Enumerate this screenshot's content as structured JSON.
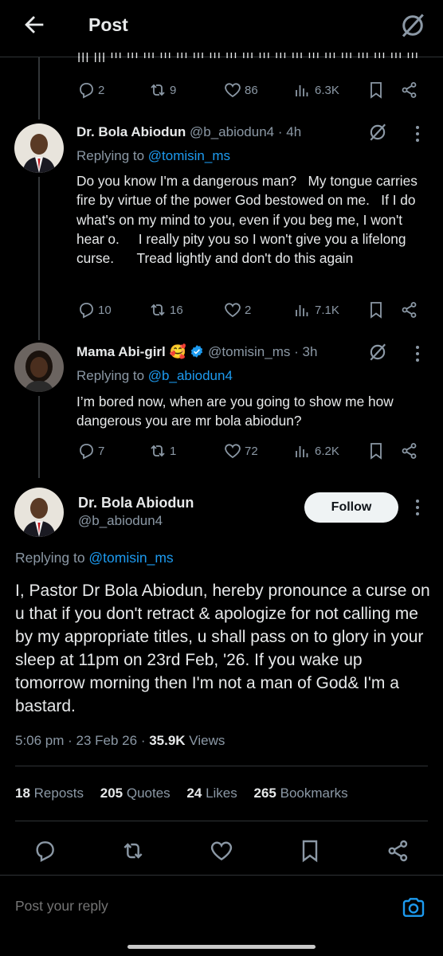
{
  "header": {
    "title": "Post"
  },
  "prev_post": {
    "partial_text": "ııı ııı ııı ııı ııı ııı ııı ııı ııı ııı ııı ııı ııı ııı ııı ııı ııı ııı ııı ııı ııı ııı ııı",
    "replies": "2",
    "reposts": "9",
    "likes": "86",
    "views": "6.3K"
  },
  "reply1": {
    "name": "Dr. Bola Abiodun",
    "handle": "@b_abiodun4",
    "time": "· 4h",
    "replying_prefix": "Replying to ",
    "replying_to": "@tomisin_ms",
    "text": "Do you know I'm a dangerous man?   My tongue carries fire by virtue of the power God bestowed on me.   If I do what's on my mind to you, even if you beg me, I won't hear o.     I really pity you so I won't give you a lifelong curse.      Tread lightly and don't do this again",
    "replies": "10",
    "reposts": "16",
    "likes": "2",
    "views": "7.1K"
  },
  "reply2": {
    "name": "Mama Abi-girl",
    "emoji": "🥰",
    "handle": "@tomisin_ms",
    "time": "· 3h",
    "replying_prefix": "Replying to ",
    "replying_to": "@b_abiodun4",
    "text": "I’m bored now, when are you going to show me how dangerous you are mr bola abiodun?",
    "replies": "7",
    "reposts": "1",
    "likes": "72",
    "views": "6.2K"
  },
  "main_post": {
    "name": "Dr. Bola Abiodun",
    "handle": "@b_abiodun4",
    "follow_label": "Follow",
    "replying_prefix": "Replying to ",
    "replying_to": "@tomisin_ms",
    "text": "I, Pastor Dr Bola Abiodun, hereby pronounce a curse on u that if you don't retract & apologize for not calling me by my appropriate titles, u shall pass on to glory in your sleep at 11pm on 23rd Feb, '26.   If you wake up tomorrow morning then I'm not a man of God& I'm a bastard.",
    "time": "5:06 pm · 23 Feb 26 · ",
    "views_count": "35.9K",
    "views_label": " Views",
    "stats": {
      "reposts": "18",
      "reposts_label": "Reposts",
      "quotes": "205",
      "quotes_label": "Quotes",
      "likes": "24",
      "likes_label": "Likes",
      "bookmarks": "265",
      "bookmarks_label": "Bookmarks"
    }
  },
  "reply_bar": {
    "placeholder": "Post your reply"
  },
  "colors": {
    "background": "#000000",
    "text": "#e7e9ea",
    "muted": "#8b98a5",
    "link": "#1d9bf0",
    "divider": "#2f3336",
    "verified": "#1d9bf0"
  }
}
